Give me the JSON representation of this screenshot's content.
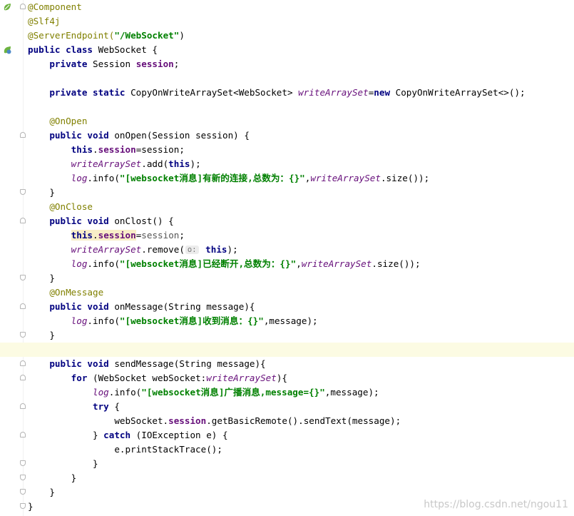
{
  "lines": [
    "@Component",
    "@Slf4j",
    "@ServerEndpoint(\"/WebSocket\")",
    "public class WebSocket {",
    "private Session session;",
    "",
    "private static CopyOnWriteArraySet<WebSocket> writeArraySet=new CopyOnWriteArraySet<>();",
    "",
    "@OnOpen",
    "public void onOpen(Session session) {",
    "this.session=session;",
    "writeArraySet.add(this);",
    "log.info(\"[websocket消息]有新的连接,总数为：{}\",writeArraySet.size());",
    "}",
    "@OnClose",
    "public void onClost() {",
    "this.session=session;",
    "writeArraySet.remove( o: this);",
    "log.info(\"[websocket消息]已经断开,总数为：{}\",writeArraySet.size());",
    "}",
    "@OnMessage",
    "public void onMessage(String message){",
    "log.info(\"[websocket消息]收到消息：{}\",message);",
    "}",
    "",
    "public void sendMessage(String message){",
    "for (WebSocket webSocket:writeArraySet){",
    "log.info(\"[websocket消息]广播消息,message={}\",message);",
    "try {",
    "webSocket.session.getBasicRemote().sendText(message);",
    "} catch (IOException e) {",
    "e.printStackTrace();",
    "}",
    "}",
    "}",
    "}"
  ],
  "hint_param": "o:",
  "watermark": "https://blog.csdn.net/ngou11",
  "icons": {
    "line1": "spring-bean-icon",
    "line4": "spring-bean-icon"
  },
  "colors": {
    "keyword": "#000080",
    "annotation": "#808000",
    "string": "#008000",
    "field": "#660e7a",
    "caret_row": "#fcfbe3"
  }
}
